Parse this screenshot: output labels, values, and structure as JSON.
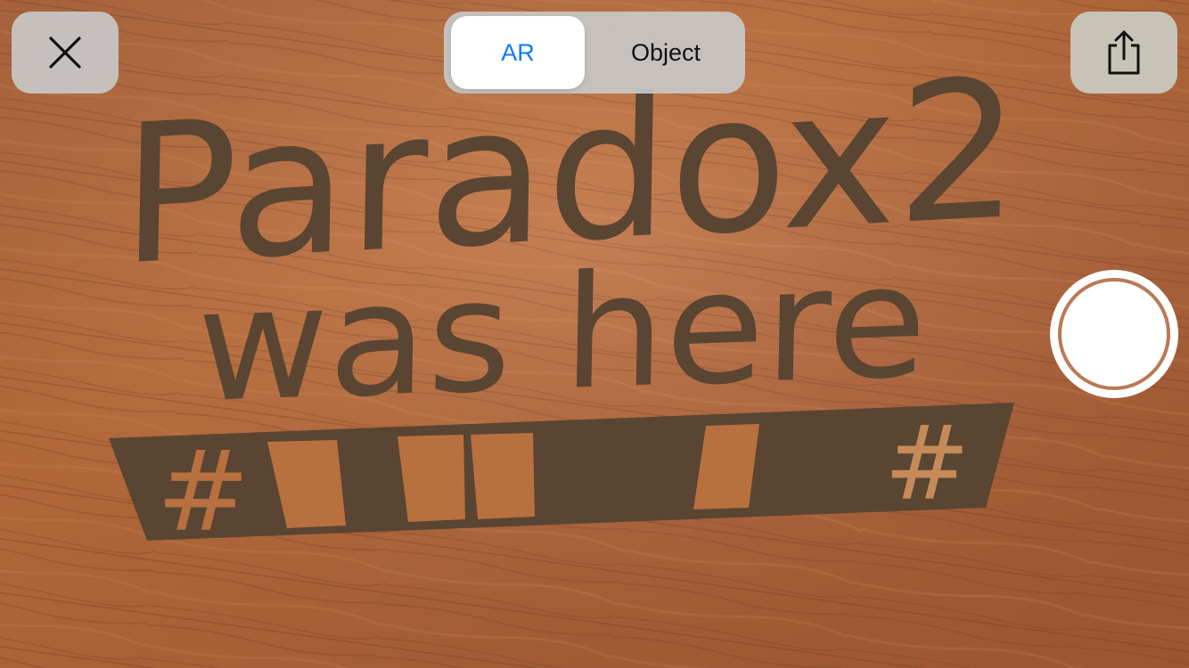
{
  "controls": {
    "close_icon": "close-icon",
    "share_icon": "share-icon",
    "segments": [
      {
        "label": "AR",
        "selected": true
      },
      {
        "label": "Object",
        "selected": false
      }
    ],
    "shutter": "shutter-button"
  },
  "ar_content": {
    "line1": "Paradox2",
    "line2": "was here",
    "banner_left_symbol": "#",
    "banner_right_symbol": "#"
  },
  "colors": {
    "accent": "#0a7aff",
    "ar_text": "#5a4532",
    "floor": "#b86a3c",
    "shutter_ring": "#b97a55"
  }
}
